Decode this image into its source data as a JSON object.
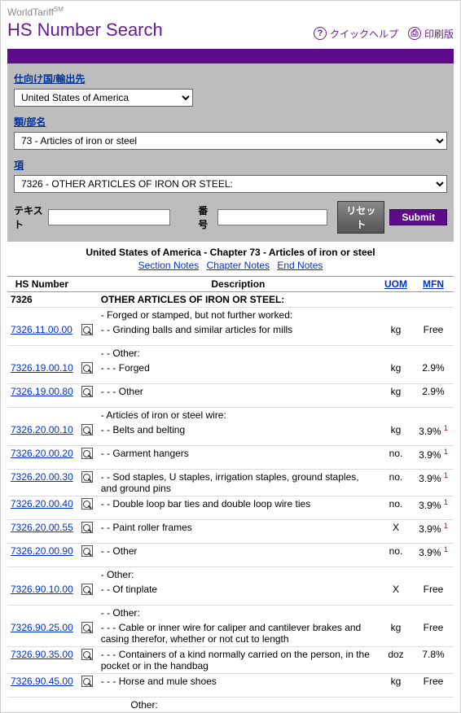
{
  "brand": {
    "name": "WorldTariff",
    "sm": "SM"
  },
  "page_title": "HS Number Search",
  "header_links": {
    "quick_help": "クイックヘルプ",
    "print": "印刷版"
  },
  "labels": {
    "destination": "仕向け国/輸出先",
    "category": "類/部名",
    "heading": "項",
    "text": "テキスト",
    "number": "番号",
    "reset": "リセット",
    "submit": "Submit"
  },
  "selects": {
    "country": "United States of America",
    "category": "73 - Articles of iron or steel",
    "heading": "7326 - OTHER ARTICLES OF IRON OR STEEL:"
  },
  "inputs": {
    "text": "",
    "number": ""
  },
  "chapter_title": "United States of America - Chapter 73 - Articles of iron or steel",
  "note_links": {
    "section": "Section Notes",
    "chapter": "Chapter Notes",
    "end": "End Notes"
  },
  "columns": {
    "hs": "HS Number",
    "desc": "Description",
    "uom": "UOM",
    "mfn": "MFN"
  },
  "rows": [
    {
      "hs": "7326",
      "bold": true,
      "desc": "OTHER ARTICLES OF IRON OR STEEL:",
      "uom": "",
      "mfn": "",
      "icon": false
    },
    {
      "hs": "",
      "desc": "-  Forged or stamped, but not further worked:",
      "uom": "",
      "mfn": "",
      "icon": false,
      "noborder": true
    },
    {
      "hs": "7326.11.00.00",
      "desc": "- -   Grinding balls and similar articles for mills",
      "uom": "kg",
      "mfn": "Free",
      "icon": true
    },
    {
      "hs": "",
      "desc": "- -   Other:",
      "uom": "",
      "mfn": "",
      "icon": false,
      "noborder": true
    },
    {
      "hs": "7326.19.00.10",
      "desc": "- - -   Forged",
      "uom": "kg",
      "mfn": "2.9%",
      "icon": true
    },
    {
      "hs": "7326.19.00.80",
      "desc": "- - -   Other",
      "uom": "kg",
      "mfn": "2.9%",
      "icon": true
    },
    {
      "hs": "",
      "desc": "-  Articles of iron or steel wire:",
      "uom": "",
      "mfn": "",
      "icon": false,
      "noborder": true
    },
    {
      "hs": "7326.20.00.10",
      "desc": "- -   Belts and belting",
      "uom": "kg",
      "mfn": "3.9%",
      "sup": "1",
      "icon": true
    },
    {
      "hs": "7326.20.00.20",
      "desc": "- -   Garment hangers",
      "uom": "no.",
      "mfn": "3.9%",
      "sup": "1",
      "icon": true
    },
    {
      "hs": "7326.20.00.30",
      "desc": "- -   Sod staples, U staples, irrigation staples, ground staples, and ground pins",
      "uom": "no.",
      "mfn": "3.9%",
      "sup": "1",
      "icon": true
    },
    {
      "hs": "7326.20.00.40",
      "desc": "- -   Double loop bar ties and double loop wire ties",
      "uom": "no.",
      "mfn": "3.9%",
      "sup": "1",
      "icon": true
    },
    {
      "hs": "7326.20.00.55",
      "desc": "- -   Paint roller frames",
      "uom": "X",
      "mfn": "3.9%",
      "sup": "1",
      "icon": true
    },
    {
      "hs": "7326.20.00.90",
      "desc": "- -   Other",
      "uom": "no.",
      "mfn": "3.9%",
      "sup": "1",
      "icon": true
    },
    {
      "hs": "",
      "desc": "-  Other:",
      "uom": "",
      "mfn": "",
      "icon": false,
      "noborder": true
    },
    {
      "hs": "7326.90.10.00",
      "desc": "- -   Of tinplate",
      "uom": "X",
      "mfn": "Free",
      "icon": true
    },
    {
      "hs": "",
      "desc": "- -   Other:",
      "uom": "",
      "mfn": "",
      "icon": false,
      "noborder": true
    },
    {
      "hs": "7326.90.25.00",
      "desc": "- - -   Cable or inner wire for caliper and cantilever brakes and casing therefor, whether or not cut to length",
      "uom": "kg",
      "mfn": "Free",
      "icon": true
    },
    {
      "hs": "7326.90.35.00",
      "desc": "- - -   Containers of a kind normally carried on the person, in the pocket or in the handbag",
      "uom": "doz",
      "mfn": "7.8%",
      "icon": true
    },
    {
      "hs": "7326.90.45.00",
      "desc": "- - -   Horse and mule shoes",
      "uom": "kg",
      "mfn": "Free",
      "icon": true
    },
    {
      "hs": "",
      "desc": "           Other:",
      "uom": "",
      "mfn": "",
      "icon": false,
      "noborder": true,
      "trailing": true
    }
  ]
}
